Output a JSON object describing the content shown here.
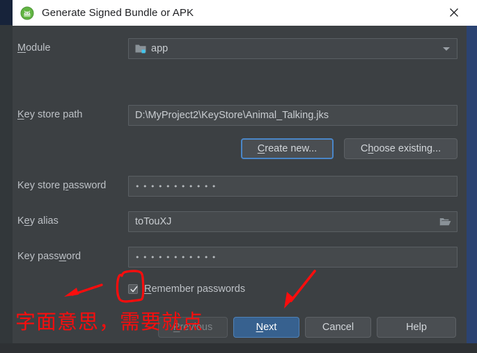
{
  "window": {
    "title": "Generate Signed Bundle or APK",
    "app_icon": "android-studio-icon",
    "close_icon": "close-icon",
    "titlebar_bg": "#ffffff",
    "dialog_bg": "#3c4043",
    "border_color": "#2b4372"
  },
  "form": {
    "module": {
      "label": "Module",
      "mnemonic": "M",
      "value": "app",
      "icon": "module-folder-icon",
      "dropdown_icon": "chevron-down-icon"
    },
    "key_store_path": {
      "label": "Key store path",
      "mnemonic": "K",
      "value": "D:\\MyProject2\\KeyStore\\Animal_Talking.jks"
    },
    "create_new": {
      "label": "Create new...",
      "mnemonic": "C",
      "focused": true
    },
    "choose_existing": {
      "label": "Choose existing...",
      "mnemonic": "h"
    },
    "key_store_password": {
      "label": "Key store password",
      "mnemonic": "p",
      "value": "•••••••••••"
    },
    "key_alias": {
      "label": "Key alias",
      "mnemonic": "e",
      "value": "toTouXJ",
      "browse_icon": "folder-open-icon"
    },
    "key_password": {
      "label": "Key password",
      "mnemonic": "w",
      "value": "•••••••••••"
    },
    "remember_passwords": {
      "label": "Remember passwords",
      "mnemonic": "R",
      "checked": true
    }
  },
  "buttons": {
    "previous": {
      "label": "Previous",
      "mnemonic": "P",
      "disabled": true
    },
    "next": {
      "label": "Next",
      "mnemonic": "N",
      "primary": true
    },
    "cancel": {
      "label": "Cancel"
    },
    "help": {
      "label": "Help"
    }
  },
  "annotations": {
    "color": "#fb0d0d",
    "note_text": "字面意思，需要就点",
    "checkbox_highlight": "hand-drawn-rectangle",
    "arrow_left": "arrow-pointing-left",
    "arrow_to_next": "arrow-pointing-to-next-button"
  }
}
